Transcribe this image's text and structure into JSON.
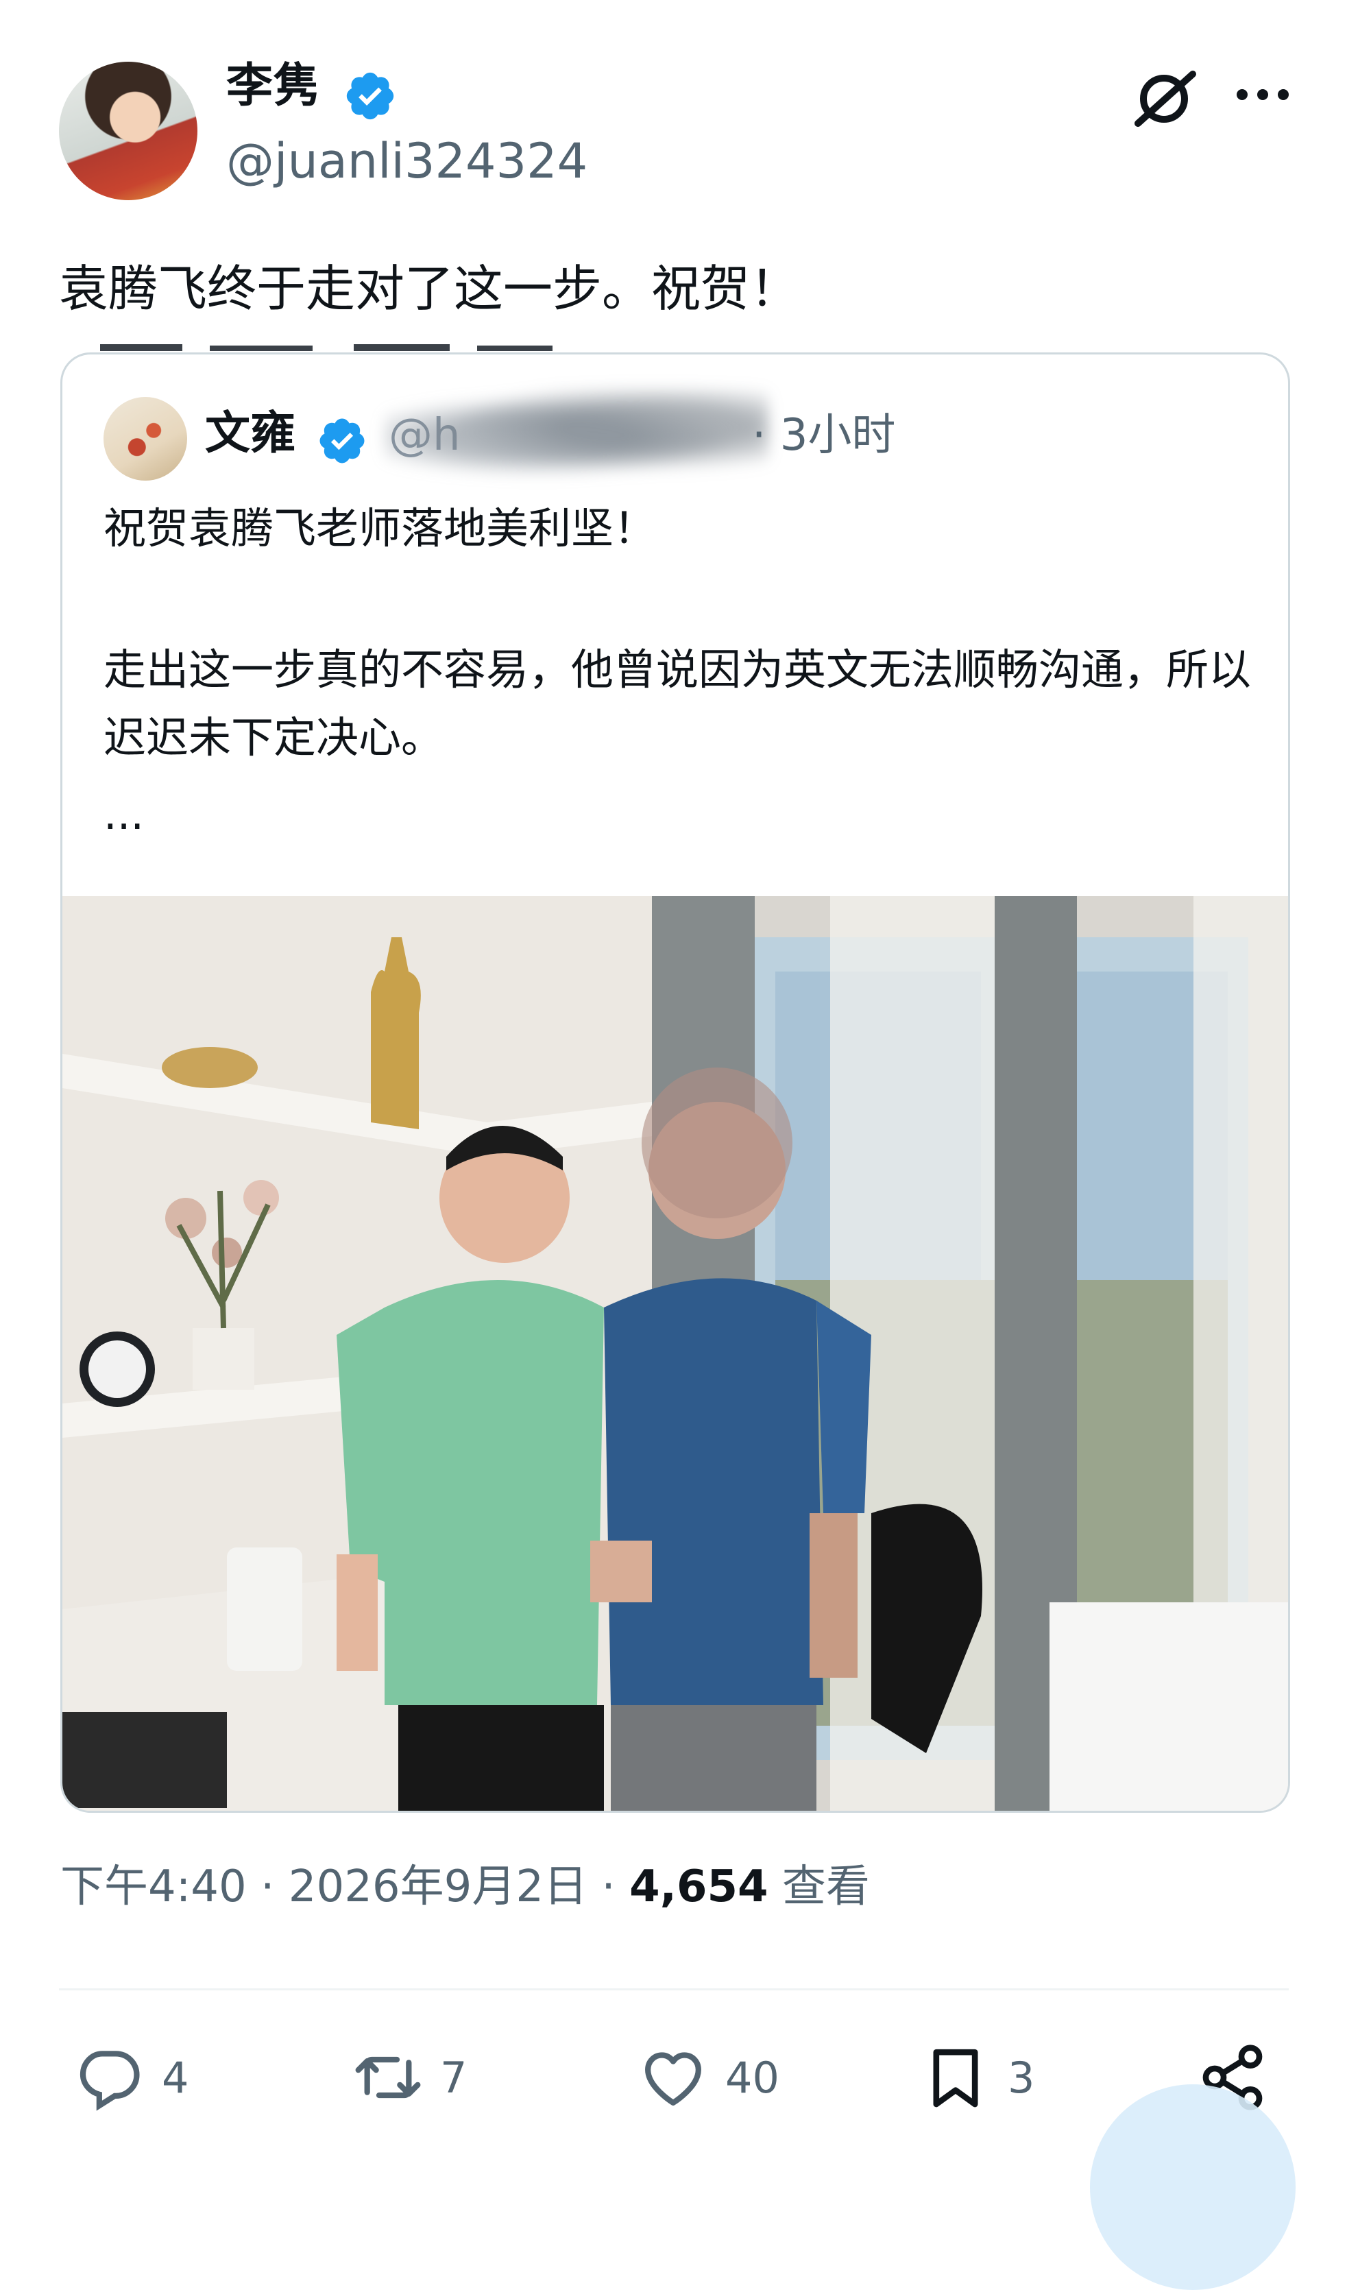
{
  "author": {
    "display_name": "李隽",
    "handle": "@juanli324324"
  },
  "tweet": {
    "text": "袁腾飞终于走对了这一步。祝贺！"
  },
  "quoted": {
    "display_name": "文雍",
    "handle": "@h",
    "time": "· 3小时",
    "line1": "祝贺袁腾飞老师落地美利坚！",
    "line2": "走出这一步真的不容易，他曾说因为英文无法顺畅沟通，所以迟迟未下定决心。",
    "ellipsis": "..."
  },
  "meta": {
    "time": "下午4:40",
    "sep1": " · ",
    "date": "2026年9月2日",
    "sep2": " · ",
    "views": "4,654",
    "views_label": " 查看"
  },
  "actions": {
    "replies": "4",
    "retweets": "7",
    "likes": "40",
    "bookmarks": "3"
  },
  "colors": {
    "verified": "#1d9bf0",
    "secondary_text": "#536471",
    "border": "#cfd9de"
  },
  "icons": [
    "verified-icon",
    "grok-icon",
    "more-icon",
    "reply-icon",
    "retweet-icon",
    "like-icon",
    "bookmark-icon",
    "share-icon"
  ]
}
